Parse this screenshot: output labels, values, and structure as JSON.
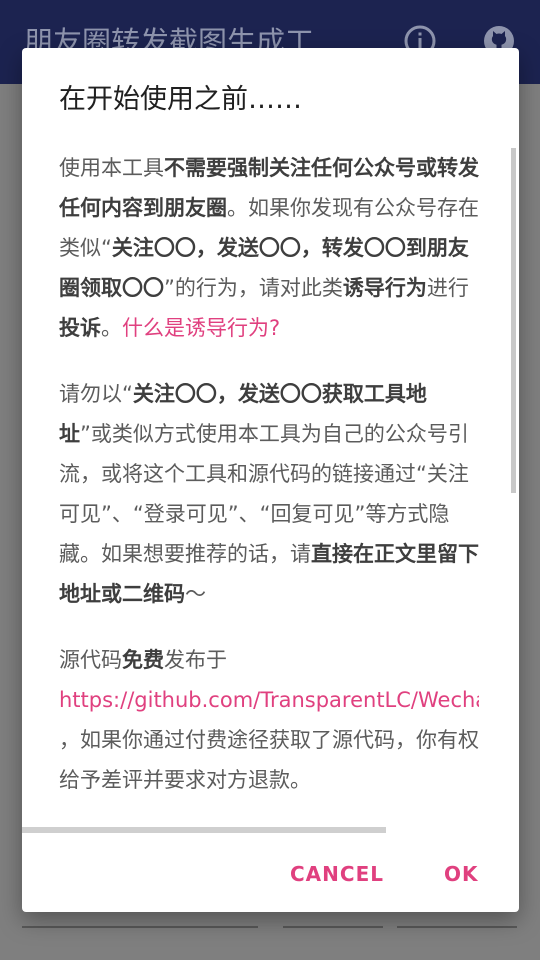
{
  "appbar": {
    "title": "朋友圈转发截图生成工...",
    "info_icon": "info-icon",
    "github_icon": "github-icon"
  },
  "dialog": {
    "title": "在开始使用之前……",
    "p1": [
      {
        "t": "使用本工具",
        "b": false
      },
      {
        "t": "不需要强制关注任何公众号或转发任何内容到朋友圈",
        "b": true
      },
      {
        "t": "。如果你发现有公众号存在类似“",
        "b": false
      },
      {
        "t": "关注〇〇，发送〇〇，转发〇〇到朋友圈领取〇〇",
        "b": true
      },
      {
        "t": "”的行为，请对此类",
        "b": false
      },
      {
        "t": "诱导行为",
        "b": true
      },
      {
        "t": "进行",
        "b": false
      },
      {
        "t": "投诉",
        "b": true
      },
      {
        "t": "。",
        "b": false
      }
    ],
    "p1_link": "什么是诱导行为?",
    "p2": [
      {
        "t": "请勿以“",
        "b": false
      },
      {
        "t": "关注〇〇，发送〇〇获取工具地址",
        "b": true
      },
      {
        "t": "”或类似方式使用本工具为自己的公众号引流，或将这个工具和源代码的链接通过“关注可见”、“登录可见”、“回复可见”等方式隐藏。如果想要推荐的话，请",
        "b": false
      },
      {
        "t": "直接在正文里留下地址或二维码",
        "b": true
      },
      {
        "t": "～",
        "b": false
      }
    ],
    "p3_prefix": "源代码",
    "p3_bold": "免费",
    "p3_suffix": "发布于",
    "p3_url": "https://github.com/TransparentLC/WechatMo",
    "p3_rest": "，如果你通过付费途径获取了源代码，你有权给予差评并要求对方退款。",
    "cancel_label": "CANCEL",
    "ok_label": "OK"
  },
  "colors": {
    "accent": "#e0407f",
    "appbar": "#1c2350",
    "scrim": "#7f7f7f"
  }
}
